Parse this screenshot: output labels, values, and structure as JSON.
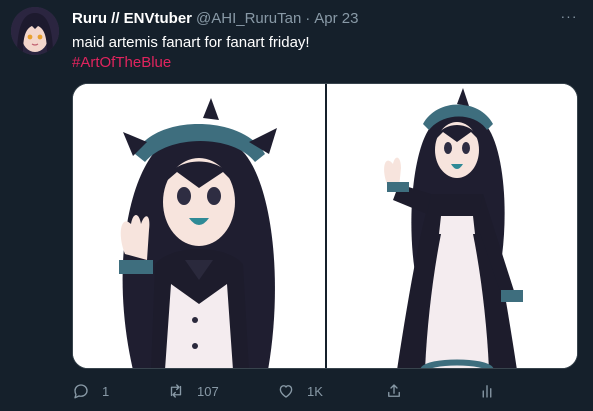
{
  "author": {
    "display_name": "Ruru // ENVtuber",
    "handle": "@AHI_RuruTan",
    "separator": "·",
    "date": "Apr 23"
  },
  "tweet": {
    "text": "maid artemis fanart for fanart friday!",
    "hashtag": "#ArtOfTheBlue"
  },
  "more_label": "···",
  "actions": {
    "reply": {
      "icon": "reply-icon",
      "count": "1"
    },
    "retweet": {
      "icon": "retweet-icon",
      "count": "107"
    },
    "like": {
      "icon": "heart-icon",
      "count": "1K"
    },
    "share": {
      "icon": "share-icon"
    },
    "analytics": {
      "icon": "analytics-icon"
    }
  },
  "media": [
    {
      "icon": "image",
      "subject": "maid-artwork-closeup"
    },
    {
      "icon": "image",
      "subject": "maid-artwork-fullbody"
    }
  ],
  "colors": {
    "background": "#15202b",
    "secondary_text": "#8899a6",
    "hashtag": "#e0245e"
  }
}
